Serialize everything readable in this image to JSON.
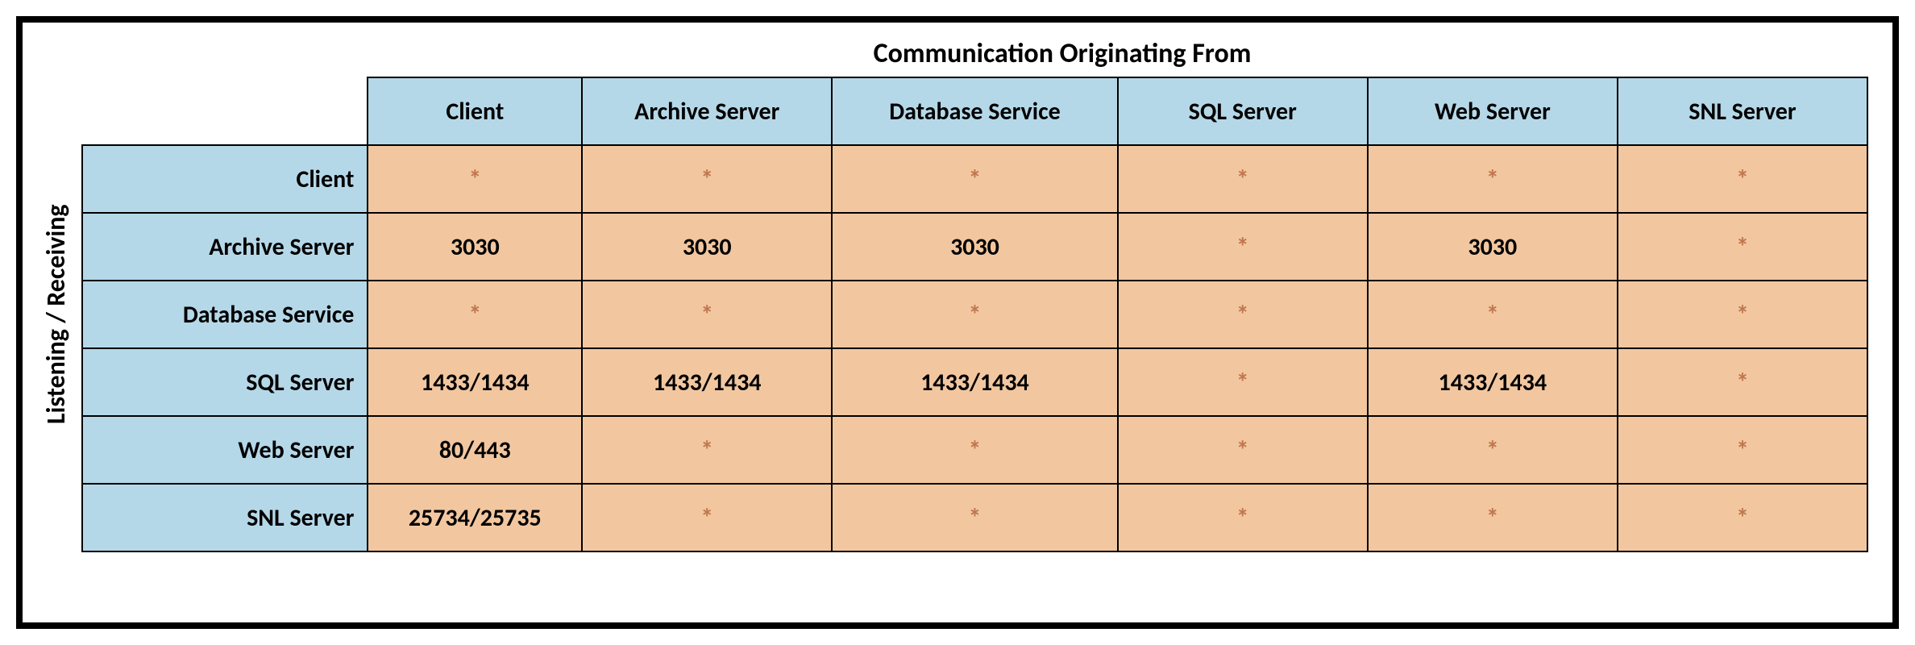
{
  "chart_data": {
    "type": "table",
    "title_top": "Communication Originating From",
    "title_side": "Listening / Receiving",
    "columns": [
      "Client",
      "Archive Server",
      "Database Service",
      "SQL Server",
      "Web Server",
      "SNL Server"
    ],
    "rows": [
      "Client",
      "Archive Server",
      "Database Service",
      "SQL Server",
      "Web Server",
      "SNL Server"
    ],
    "cells": [
      [
        "*",
        "*",
        "*",
        "*",
        "*",
        "*"
      ],
      [
        "3030",
        "3030",
        "3030",
        "*",
        "3030",
        "*"
      ],
      [
        "*",
        "*",
        "*",
        "*",
        "*",
        "*"
      ],
      [
        "1433/1434",
        "1433/1434",
        "1433/1434",
        "*",
        "1433/1434",
        "*"
      ],
      [
        "80/443",
        "*",
        "*",
        "*",
        "*",
        "*"
      ],
      [
        "25734/25735",
        "*",
        "*",
        "*",
        "*",
        "*"
      ]
    ]
  }
}
